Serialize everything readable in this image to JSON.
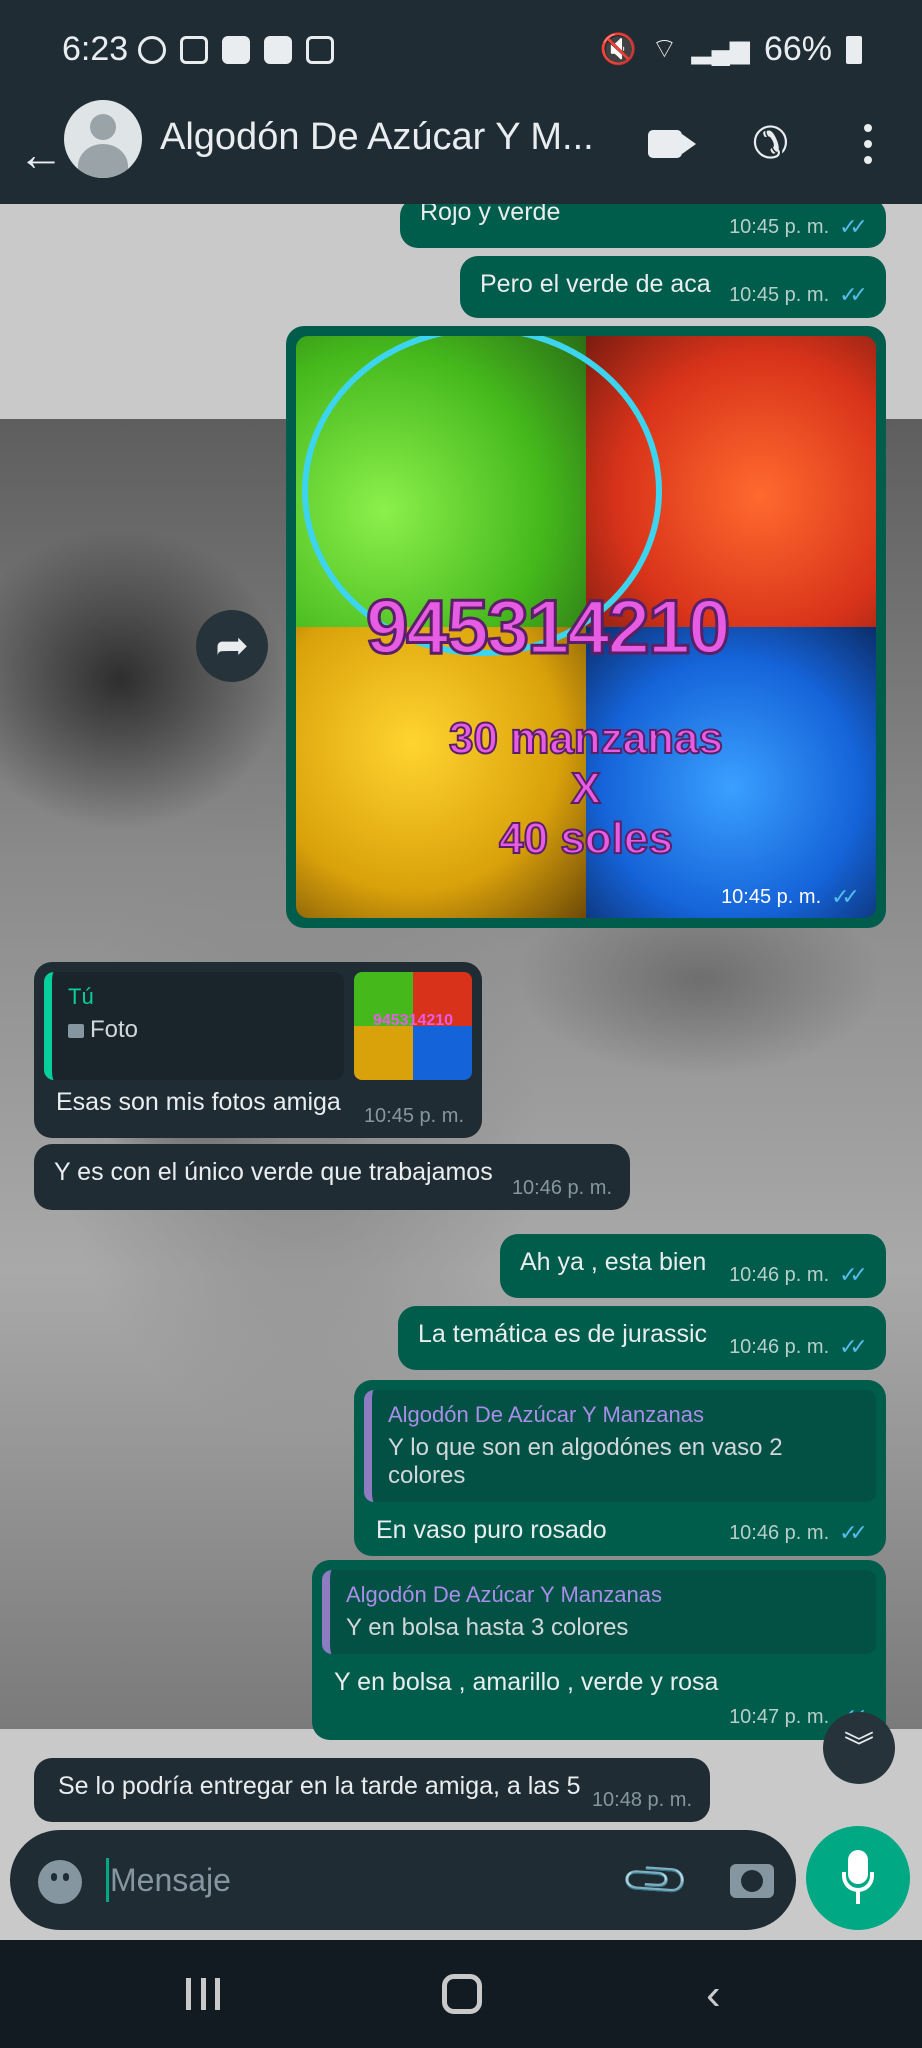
{
  "status_bar": {
    "time": "6:23",
    "battery": "66%",
    "icons": [
      "messenger-icon",
      "instagram-icon",
      "folder-icon",
      "checkbox-icon",
      "gallery-icon",
      "mute-icon",
      "wifi-icon",
      "signal-icon",
      "battery-icon"
    ]
  },
  "header": {
    "contact_name": "Algodón De Azúcar Y M..."
  },
  "messages": {
    "m1": {
      "text": "Rojo y verde",
      "time": "10:45 p. m."
    },
    "m2": {
      "text": "Pero el verde de aca",
      "time": "10:45 p. m."
    },
    "image": {
      "phone": "945314210",
      "line1": "30 manzanas",
      "line2": "X",
      "line3": "40 soles",
      "time": "10:45 p. m."
    },
    "m3": {
      "quote_author": "Tú",
      "quote_text": "Foto",
      "thumb_text": "945314210",
      "text": "Esas son mis fotos amiga",
      "time": "10:45 p. m."
    },
    "m4": {
      "text": "Y es con el único verde que trabajamos",
      "time": "10:46 p. m."
    },
    "m5": {
      "text": "Ah ya , esta bien",
      "time": "10:46 p. m."
    },
    "m6": {
      "text": "La temática es de jurassic",
      "time": "10:46 p. m."
    },
    "m7": {
      "quote_author": "Algodón De Azúcar Y Manzanas",
      "quote_text": "Y lo que son en algodónes en vaso 2 colores",
      "text": "En vaso puro rosado",
      "time": "10:46 p. m."
    },
    "m8": {
      "quote_author": "Algodón De Azúcar Y Manzanas",
      "quote_text": "Y en bolsa hasta 3 colores",
      "text": "Y en bolsa , amarillo , verde y rosa",
      "time": "10:47 p. m."
    },
    "m9": {
      "text": "Se lo podría entregar en la tarde amiga, a las 5",
      "time": "10:48 p. m."
    }
  },
  "composer": {
    "placeholder": "Mensaje"
  },
  "colors": {
    "outgoing_bubble": "#005c4b",
    "incoming_bubble": "#202c33",
    "accent": "#00a884",
    "read_ticks": "#53bdeb"
  }
}
